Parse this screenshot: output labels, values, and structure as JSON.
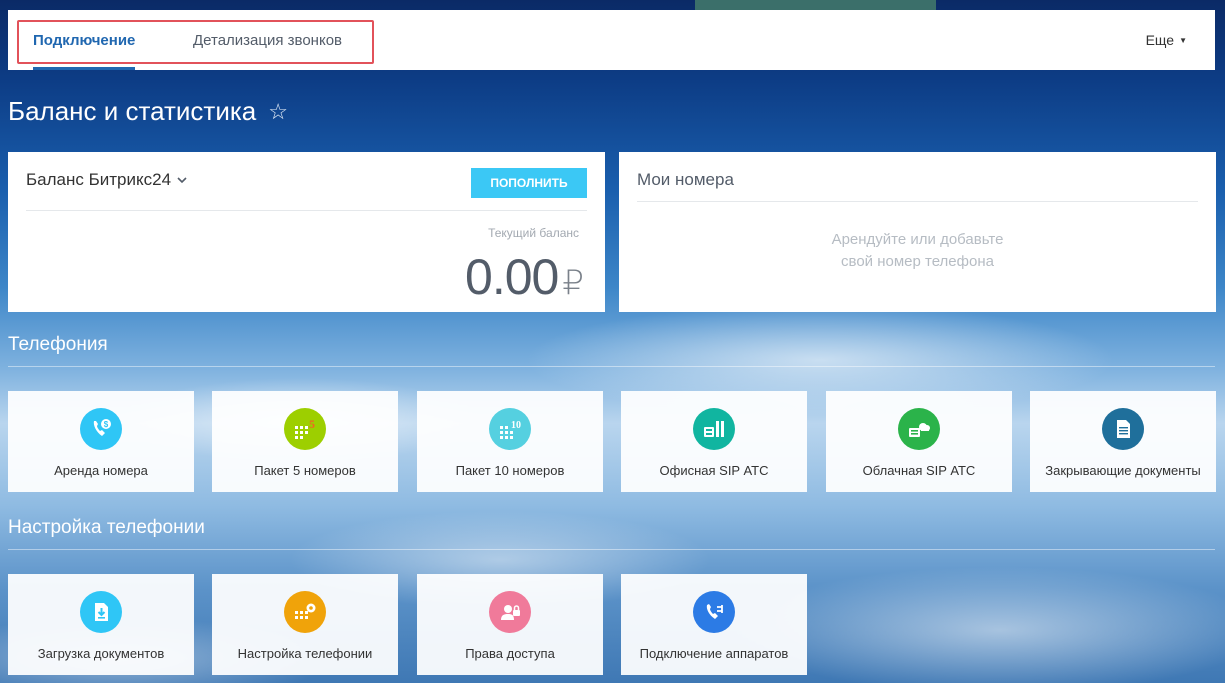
{
  "tabs": [
    {
      "label": "Подключение",
      "active": true
    },
    {
      "label": "Детализация звонков",
      "active": false
    }
  ],
  "more": {
    "label": "Еще"
  },
  "page": {
    "title": "Баланс и статистика"
  },
  "balance": {
    "selector": "Баланс Битрикс24",
    "topup_label": "ПОПОЛНИТЬ",
    "current_label": "Текущий баланс",
    "amount": "0.00",
    "currency": "₽"
  },
  "numbers": {
    "title": "Мои номера",
    "empty_line1": "Арендуйте или добавьте",
    "empty_line2": "свой номер телефона"
  },
  "telephony": {
    "title": "Телефония",
    "tiles": [
      {
        "label": "Аренда номера",
        "icon": "phone-rent-icon",
        "color": "#2fc6f6"
      },
      {
        "label": "Пакет 5 номеров",
        "icon": "package-5-icon",
        "color": "#9dcf00",
        "badge": "5"
      },
      {
        "label": "Пакет 10 номеров",
        "icon": "package-10-icon",
        "color": "#55d0e0",
        "badge": "10"
      },
      {
        "label": "Офисная SIP АТС",
        "icon": "office-sip-icon",
        "color": "#11b5a0"
      },
      {
        "label": "Облачная SIP АТС",
        "icon": "cloud-sip-icon",
        "color": "#2bb34a"
      },
      {
        "label": "Закрывающие документы",
        "icon": "closing-docs-icon",
        "color": "#1f6f9b"
      }
    ]
  },
  "settings": {
    "title": "Настройка телефонии",
    "tiles": [
      {
        "label": "Загрузка документов",
        "icon": "upload-docs-icon",
        "color": "#2fc6f6"
      },
      {
        "label": "Настройка телефонии",
        "icon": "phone-settings-icon",
        "color": "#f0a30a"
      },
      {
        "label": "Права доступа",
        "icon": "access-rights-icon",
        "color": "#f07a9a"
      },
      {
        "label": "Подключение аппаратов",
        "icon": "device-connect-icon",
        "color": "#2c7be5"
      }
    ]
  }
}
